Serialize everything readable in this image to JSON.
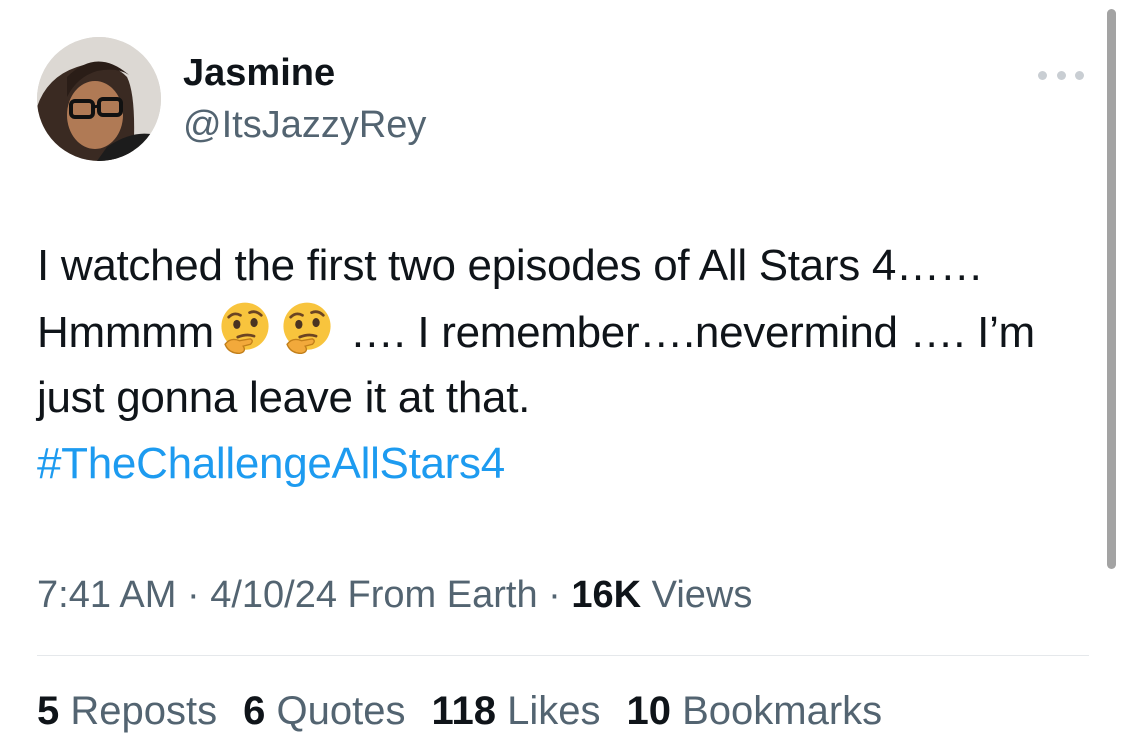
{
  "author": {
    "display_name": "Jasmine",
    "handle": "@ItsJazzyRey"
  },
  "tweet": {
    "line1": "I watched the first two episodes of All Stars 4……",
    "line2_start": "Hmmmm",
    "line2_end": " …. I remember….nevermind …. I’m",
    "line3": "just gonna leave it at that.",
    "hashtag": "#TheChallengeAllStars4",
    "emoji": "thinking-face"
  },
  "meta": {
    "time": "7:41 AM",
    "sep1": " · ",
    "date": "4/10/24",
    "source": " From Earth",
    "sep2": " · ",
    "views_count": "16K",
    "views_label": " Views"
  },
  "stats": [
    {
      "count": "5",
      "label": " Reposts"
    },
    {
      "count": "6",
      "label": " Quotes"
    },
    {
      "count": "118",
      "label": " Likes"
    },
    {
      "count": "10",
      "label": " Bookmarks"
    }
  ],
  "colors": {
    "text": "#0f1419",
    "secondary": "#536471",
    "link": "#1d9bf0",
    "divider": "#e5e8eb"
  }
}
